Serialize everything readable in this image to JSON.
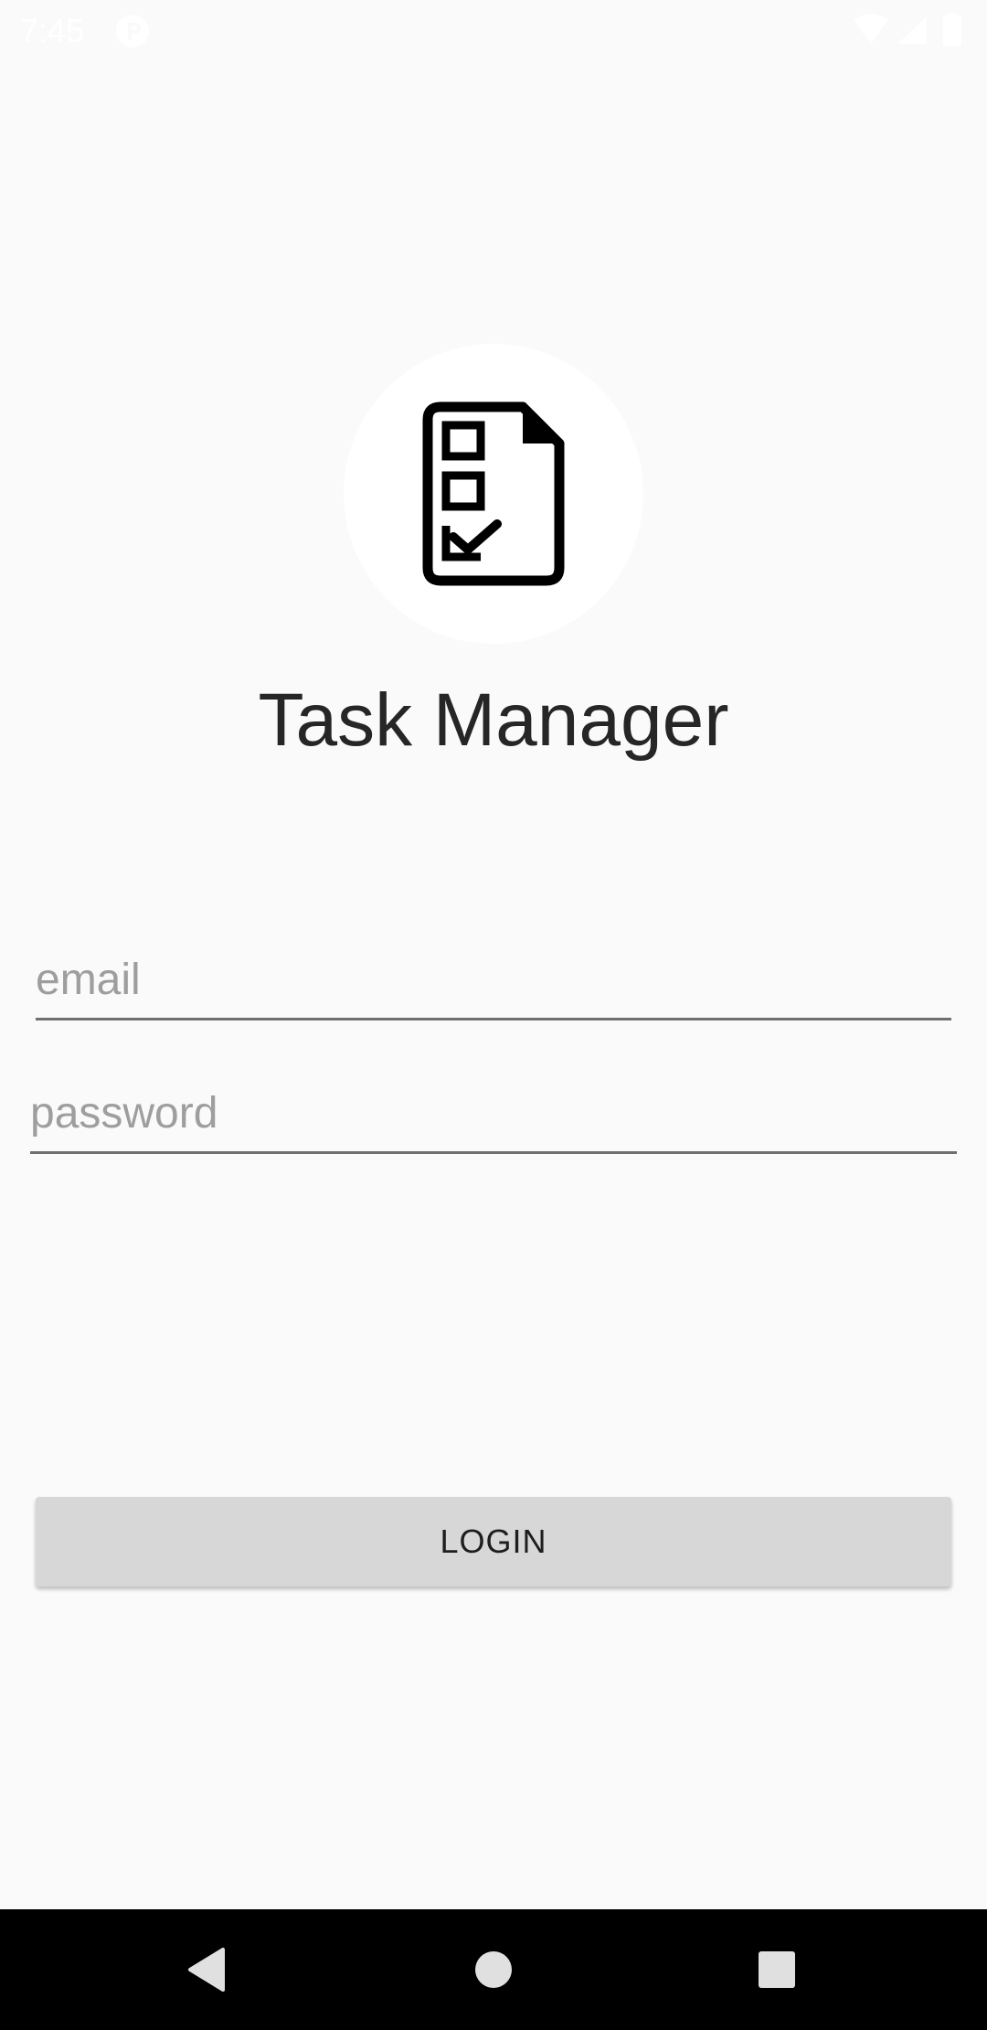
{
  "status_bar": {
    "time": "7:45",
    "icons": [
      "notification-icon",
      "wifi-icon",
      "signal-icon",
      "battery-icon"
    ]
  },
  "app": {
    "logo_icon": "checklist-document-icon",
    "title": "Task Manager"
  },
  "form": {
    "email_placeholder": "email",
    "email_value": "",
    "password_placeholder": "password",
    "password_value": ""
  },
  "login_button": {
    "label": "LOGIN"
  },
  "nav_bar": {
    "icons": [
      "back-icon",
      "home-icon",
      "recents-icon"
    ]
  },
  "colors": {
    "background": "#fafafa",
    "button": "#d7d7d7",
    "nav_bar": "#000000",
    "title_text": "#262626",
    "placeholder": "#9e9e9e"
  }
}
